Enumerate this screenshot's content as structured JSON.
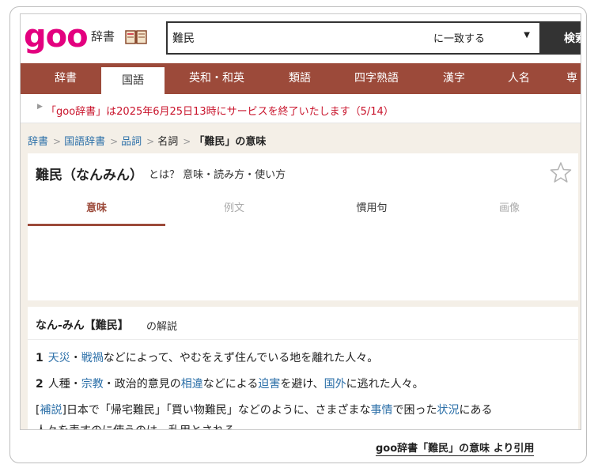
{
  "header": {
    "logo": "goo",
    "dict_label": "辞書",
    "search_value": "難民",
    "match_option": "に一致する",
    "search_button": "検索"
  },
  "nav": {
    "items": [
      {
        "label": "辞書"
      },
      {
        "label": "国語"
      },
      {
        "label": "英和・和英"
      },
      {
        "label": "類語"
      },
      {
        "label": "四字熟語"
      },
      {
        "label": "漢字"
      },
      {
        "label": "人名"
      },
      {
        "label": "専"
      }
    ],
    "active_index": 1
  },
  "notice": {
    "text": "「goo辞書」は2025年6月25日13時にサービスを終了いたします（5/14）"
  },
  "breadcrumb": {
    "items": [
      "辞書",
      "国語辞書",
      "品詞",
      "名詞"
    ],
    "current": "「難民」の意味"
  },
  "title": {
    "word": "難民（なんみん）",
    "subtitle": "とは？ 意味・読み方・使い方"
  },
  "tabs": [
    {
      "label": "意味",
      "state": "active"
    },
    {
      "label": "例文",
      "state": "disabled"
    },
    {
      "label": "慣用句",
      "state": "normal"
    },
    {
      "label": "画像",
      "state": "disabled"
    }
  ],
  "entry": {
    "headword": "なん-みん【難民】",
    "kaisetsu": "の解説",
    "sense1": {
      "num": "1",
      "w1": "天災",
      "t1": "・",
      "w2": "戦禍",
      "t2": "などによって、やむをえず住んでいる地を離れた人々。"
    },
    "sense2": {
      "num": "2",
      "t1": "人種・",
      "w1": "宗教",
      "t2": "・政治的意見の",
      "w2": "相違",
      "t3": "などによる",
      "w3": "迫害",
      "t4": "を避け、",
      "w4": "国外",
      "t5": "に逃れた人々。"
    },
    "note": {
      "tag": "補説",
      "t1": "日本で「帰宅難民」「買い物難民」などのように、さまざまな",
      "w1": "事情",
      "t2": "で困った",
      "w2": "状況",
      "t3": "にある",
      "line2": "人々を表すのに使うのは、乱用とされる。"
    }
  },
  "citation": "goo辞書「難民」の意味 より引用"
}
